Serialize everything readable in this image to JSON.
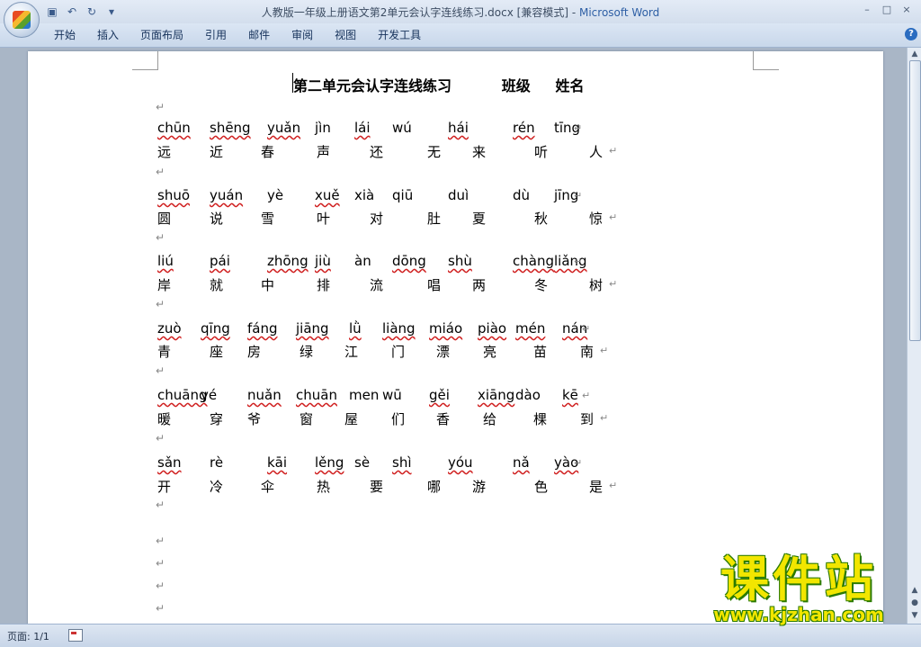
{
  "window": {
    "title": "人教版一年级上册语文第2单元会认字连线练习.docx [兼容模式] - ",
    "app_name": "Microsoft Word",
    "controls": [
      "–",
      "□",
      "×"
    ]
  },
  "quick_access": {
    "icons": [
      "save-icon",
      "undo-icon",
      "redo-icon",
      "customize-icon"
    ]
  },
  "ribbon": {
    "tabs": [
      "开始",
      "插入",
      "页面布局",
      "引用",
      "邮件",
      "审阅",
      "视图",
      "开发工具"
    ],
    "help": "?"
  },
  "document": {
    "title_line": "第二单元会认字连线练习          班级     姓名",
    "paragraph_mark": "↵",
    "rows": [
      {
        "type": "pinyin",
        "items": [
          "chūn",
          "shēng",
          "yuǎn",
          "jìn",
          "lái",
          "wú",
          "hái",
          "rén",
          "tīng"
        ]
      },
      {
        "type": "hanzi",
        "items": [
          "远",
          "近",
          "春",
          "声",
          "还",
          "无",
          "来",
          "听",
          "人"
        ]
      },
      {
        "type": "pinyin",
        "items": [
          "shuō",
          "yuán",
          "yè",
          "xuě",
          "xià",
          "qiū",
          "duì",
          "dù",
          "jīng"
        ]
      },
      {
        "type": "hanzi",
        "items": [
          "圆",
          "说",
          "雪",
          "叶",
          "对",
          "肚",
          "夏",
          "秋",
          "惊"
        ]
      },
      {
        "type": "pinyin",
        "items": [
          "liú",
          "pái",
          "zhōng",
          "jiù",
          "àn",
          "dōng",
          "shù",
          "chàng",
          "liǎng"
        ]
      },
      {
        "type": "hanzi",
        "items": [
          "岸",
          "就",
          "中",
          "排",
          "流",
          "唱",
          "两",
          "冬",
          "树"
        ]
      },
      {
        "type": "pinyin",
        "items": [
          "zuò",
          "qīng",
          "fáng",
          "jiāng",
          "lǜ",
          "liàng",
          "miáo",
          "piào",
          "mén",
          "nán"
        ]
      },
      {
        "type": "hanzi",
        "items": [
          "青",
          "座",
          "房",
          "绿",
          "江",
          "门",
          "漂",
          "亮",
          "苗",
          "南"
        ]
      },
      {
        "type": "pinyin",
        "items": [
          "chuāng",
          "yé",
          "nuǎn",
          "chuān",
          "men",
          "wū",
          "gěi",
          "xiāng",
          "dào",
          "kē"
        ]
      },
      {
        "type": "hanzi",
        "items": [
          "暖",
          "穿",
          "爷",
          "窗",
          "屋",
          "们",
          "香",
          "给",
          "棵",
          "到"
        ]
      },
      {
        "type": "pinyin",
        "items": [
          "sǎn",
          "rè",
          "kāi",
          "lěng",
          "sè",
          "shì",
          "yóu",
          "nǎ",
          "yào"
        ]
      },
      {
        "type": "hanzi",
        "items": [
          "开",
          "冷",
          "伞",
          "热",
          "要",
          "哪",
          "游",
          "色",
          "是"
        ]
      }
    ]
  },
  "statusbar": {
    "page": "页面: 1/1"
  },
  "watermark": {
    "brand": "课件站",
    "url": "www.kjzhan.com"
  },
  "colors": {
    "accent": "#2e5fa5",
    "spell_underline": "#d02020",
    "watermark": "#f2e600"
  }
}
